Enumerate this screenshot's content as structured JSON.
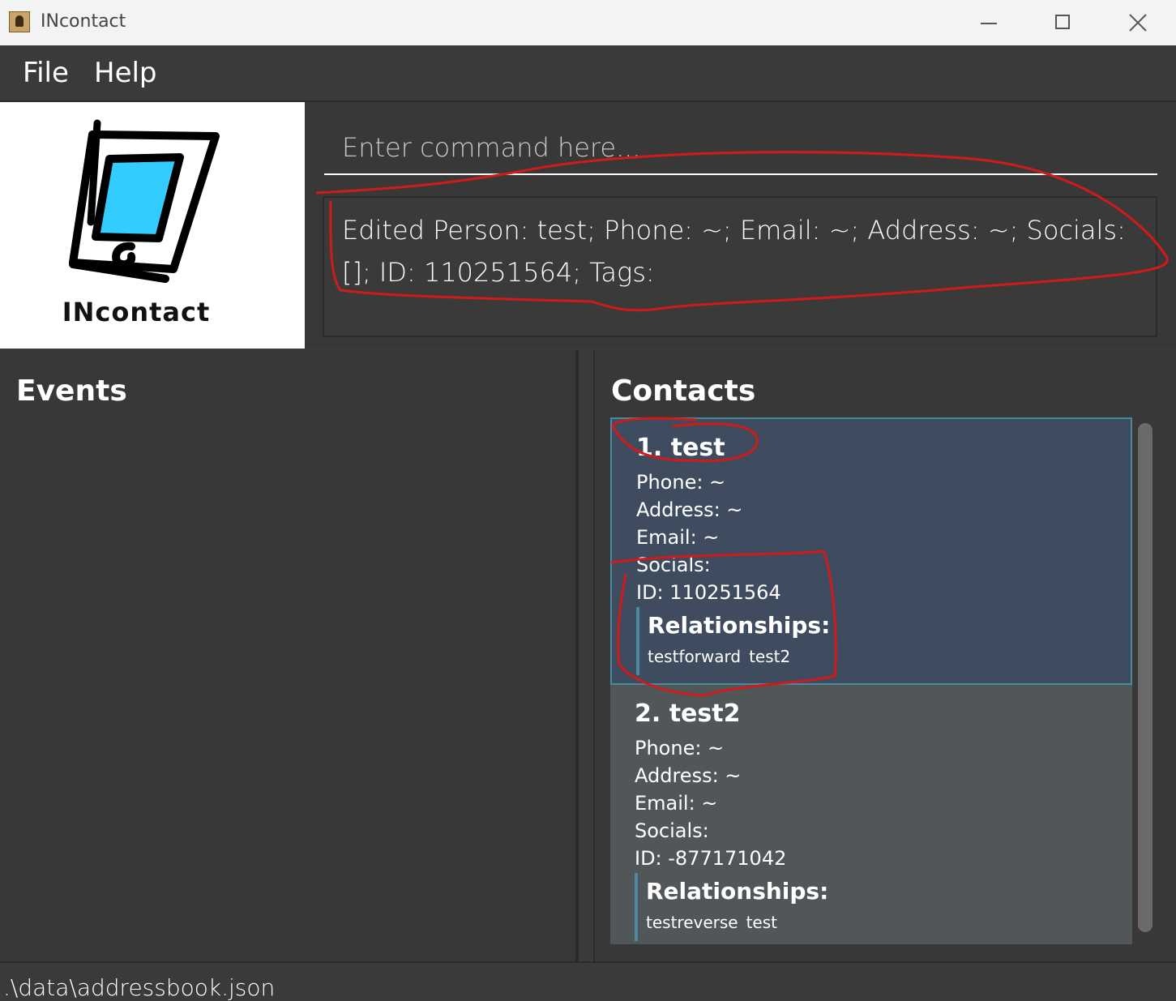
{
  "window": {
    "title": "INcontact"
  },
  "menu": {
    "items": [
      "File",
      "Help"
    ]
  },
  "logo": {
    "text": "INcontact"
  },
  "command": {
    "placeholder": "Enter command here..."
  },
  "result": {
    "text": "Edited Person: test; Phone: ~; Email: ~; Address: ~; Socials: []; ID: 110251564; Tags:"
  },
  "events": {
    "title": "Events"
  },
  "contacts": {
    "title": "Contacts",
    "cards": [
      {
        "name": "1. test",
        "phone": "Phone: ~",
        "address": "Address: ~",
        "email": "Email: ~",
        "socials": "Socials:",
        "id": "ID: 110251564",
        "relationships_label": "Relationships:",
        "relationship": [
          "testforward",
          "test2"
        ]
      },
      {
        "name": "2. test2",
        "phone": "Phone: ~",
        "address": "Address: ~",
        "email": "Email: ~",
        "socials": "Socials:",
        "id": "ID: -877171042",
        "relationships_label": "Relationships:",
        "relationship": [
          "testreverse",
          "test"
        ]
      }
    ]
  },
  "status": {
    "path": ".\\data\\addressbook.json"
  },
  "colors": {
    "annotation": "#d11a1a",
    "selected_card": "#3f4b5e",
    "selected_border": "#4a8aa0",
    "screen_logo_blue": "#33ccff"
  }
}
